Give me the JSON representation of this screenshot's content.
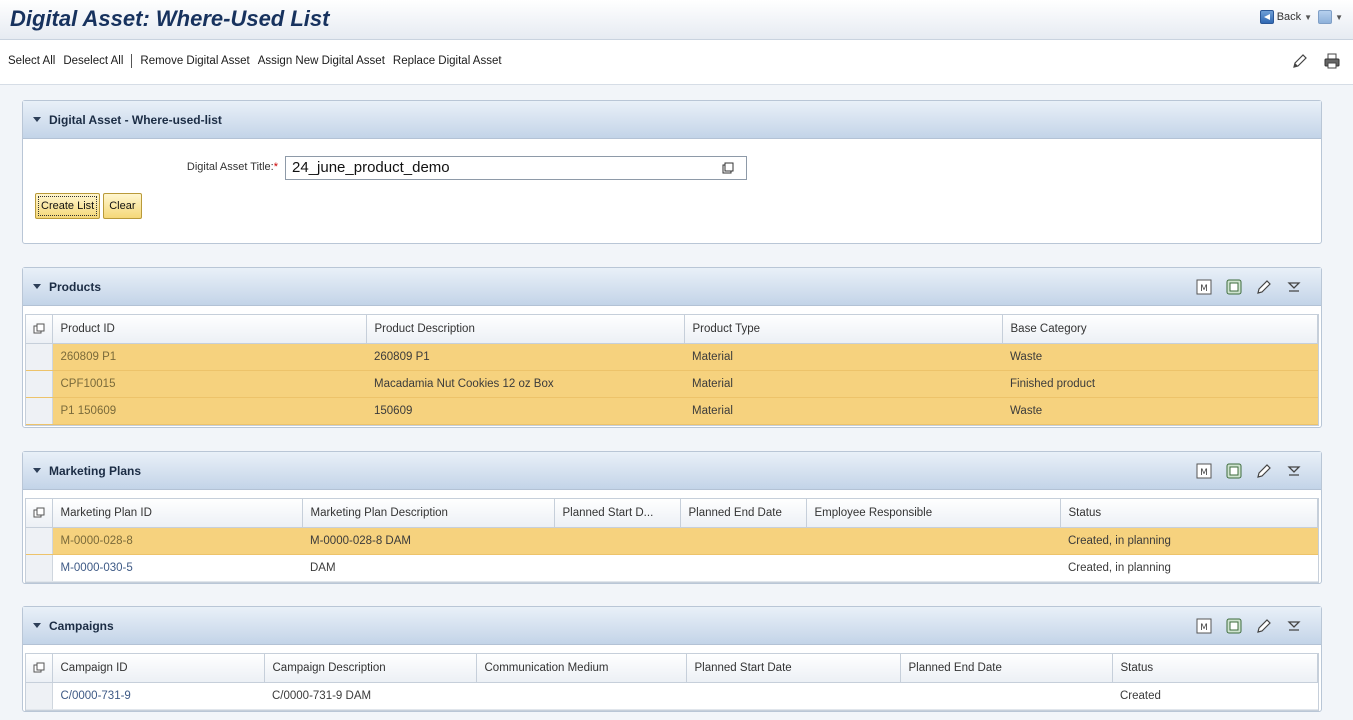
{
  "window": {
    "title": "Digital Asset: Where-Used List",
    "back_label": "Back"
  },
  "toolbar": {
    "select_all": "Select All",
    "deselect_all": "Deselect All",
    "remove": "Remove Digital Asset",
    "assign_new": "Assign New Digital Asset",
    "replace": "Replace Digital Asset"
  },
  "search_panel": {
    "title": "Digital Asset - Where-used-list",
    "field_label": "Digital Asset Title:",
    "required_mark": "*",
    "field_value": "24_june_product_demo",
    "create_button": "Create List",
    "clear_button": "Clear"
  },
  "products": {
    "title": "Products",
    "columns": [
      "Product ID",
      "Product Description",
      "Product Type",
      "Base Category"
    ],
    "rows": [
      {
        "id": "260809 P1",
        "desc": "260809 P1",
        "type": "Material",
        "category": "Waste"
      },
      {
        "id": "CPF10015",
        "desc": "Macadamia Nut Cookies 12 oz Box",
        "type": "Material",
        "category": "Finished product"
      },
      {
        "id": "P1 150609",
        "desc": "150609",
        "type": "Material",
        "category": "Waste"
      }
    ]
  },
  "marketing_plans": {
    "title": "Marketing Plans",
    "columns": [
      "Marketing Plan ID",
      "Marketing Plan Description",
      "Planned Start D...",
      "Planned End Date",
      "Employee Responsible",
      "Status"
    ],
    "rows": [
      {
        "id": "M-0000-028-8",
        "desc": "M-0000-028-8 DAM",
        "start": "",
        "end": "",
        "employee": "",
        "status": "Created, in planning"
      },
      {
        "id": "M-0000-030-5",
        "desc": "DAM",
        "start": "",
        "end": "",
        "employee": "",
        "status": "Created, in planning"
      }
    ]
  },
  "campaigns": {
    "title": "Campaigns",
    "columns": [
      "Campaign ID",
      "Campaign Description",
      "Communication Medium",
      "Planned Start Date",
      "Planned End Date",
      "Status"
    ],
    "rows": [
      {
        "id": "C/0000-731-9",
        "desc": "C/0000-731-9 DAM",
        "medium": "",
        "start": "",
        "end": "",
        "status": "Created"
      }
    ]
  },
  "colors": {
    "selected_row": "#f6d27e",
    "header_gradient_bottom": "#c3d4e8",
    "title_text": "#17325e"
  },
  "icons": [
    "back-icon",
    "forward-icon",
    "edit-pencil-icon",
    "print-icon",
    "collapse-triangle-icon",
    "table-settings-icon",
    "export-excel-icon",
    "edit-icon",
    "filter-icon",
    "value-help-icon",
    "select-all-rows-icon"
  ]
}
